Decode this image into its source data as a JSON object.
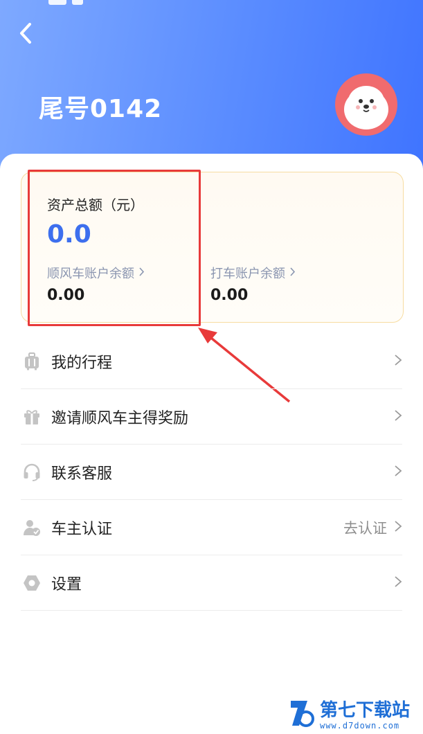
{
  "header": {
    "title": "尾号0142",
    "back_icon": "chevron-left-icon",
    "avatar_icon": "seal-avatar-icon",
    "gradient_start": "#7ea9ff",
    "gradient_end": "#3f74ff"
  },
  "assets": {
    "total_label": "资产总额（元）",
    "total_value": "0.0",
    "accounts": [
      {
        "label": "顺风车账户余额",
        "value": "0.00"
      },
      {
        "label": "打车账户余额",
        "value": "0.00"
      }
    ],
    "accent_color": "#3d6fee",
    "highlight_color": "#e83a3a"
  },
  "menu": [
    {
      "label": "我的行程",
      "icon": "luggage-icon",
      "extra": ""
    },
    {
      "label": "邀请顺风车主得奖励",
      "icon": "gift-icon",
      "extra": ""
    },
    {
      "label": "联系客服",
      "icon": "headset-icon",
      "extra": ""
    },
    {
      "label": "车主认证",
      "icon": "user-verified-icon",
      "extra": "去认证"
    },
    {
      "label": "设置",
      "icon": "hexagon-gear-icon",
      "extra": ""
    }
  ],
  "watermark": {
    "main": "第七下载站",
    "sub": "www.d7down.com"
  }
}
